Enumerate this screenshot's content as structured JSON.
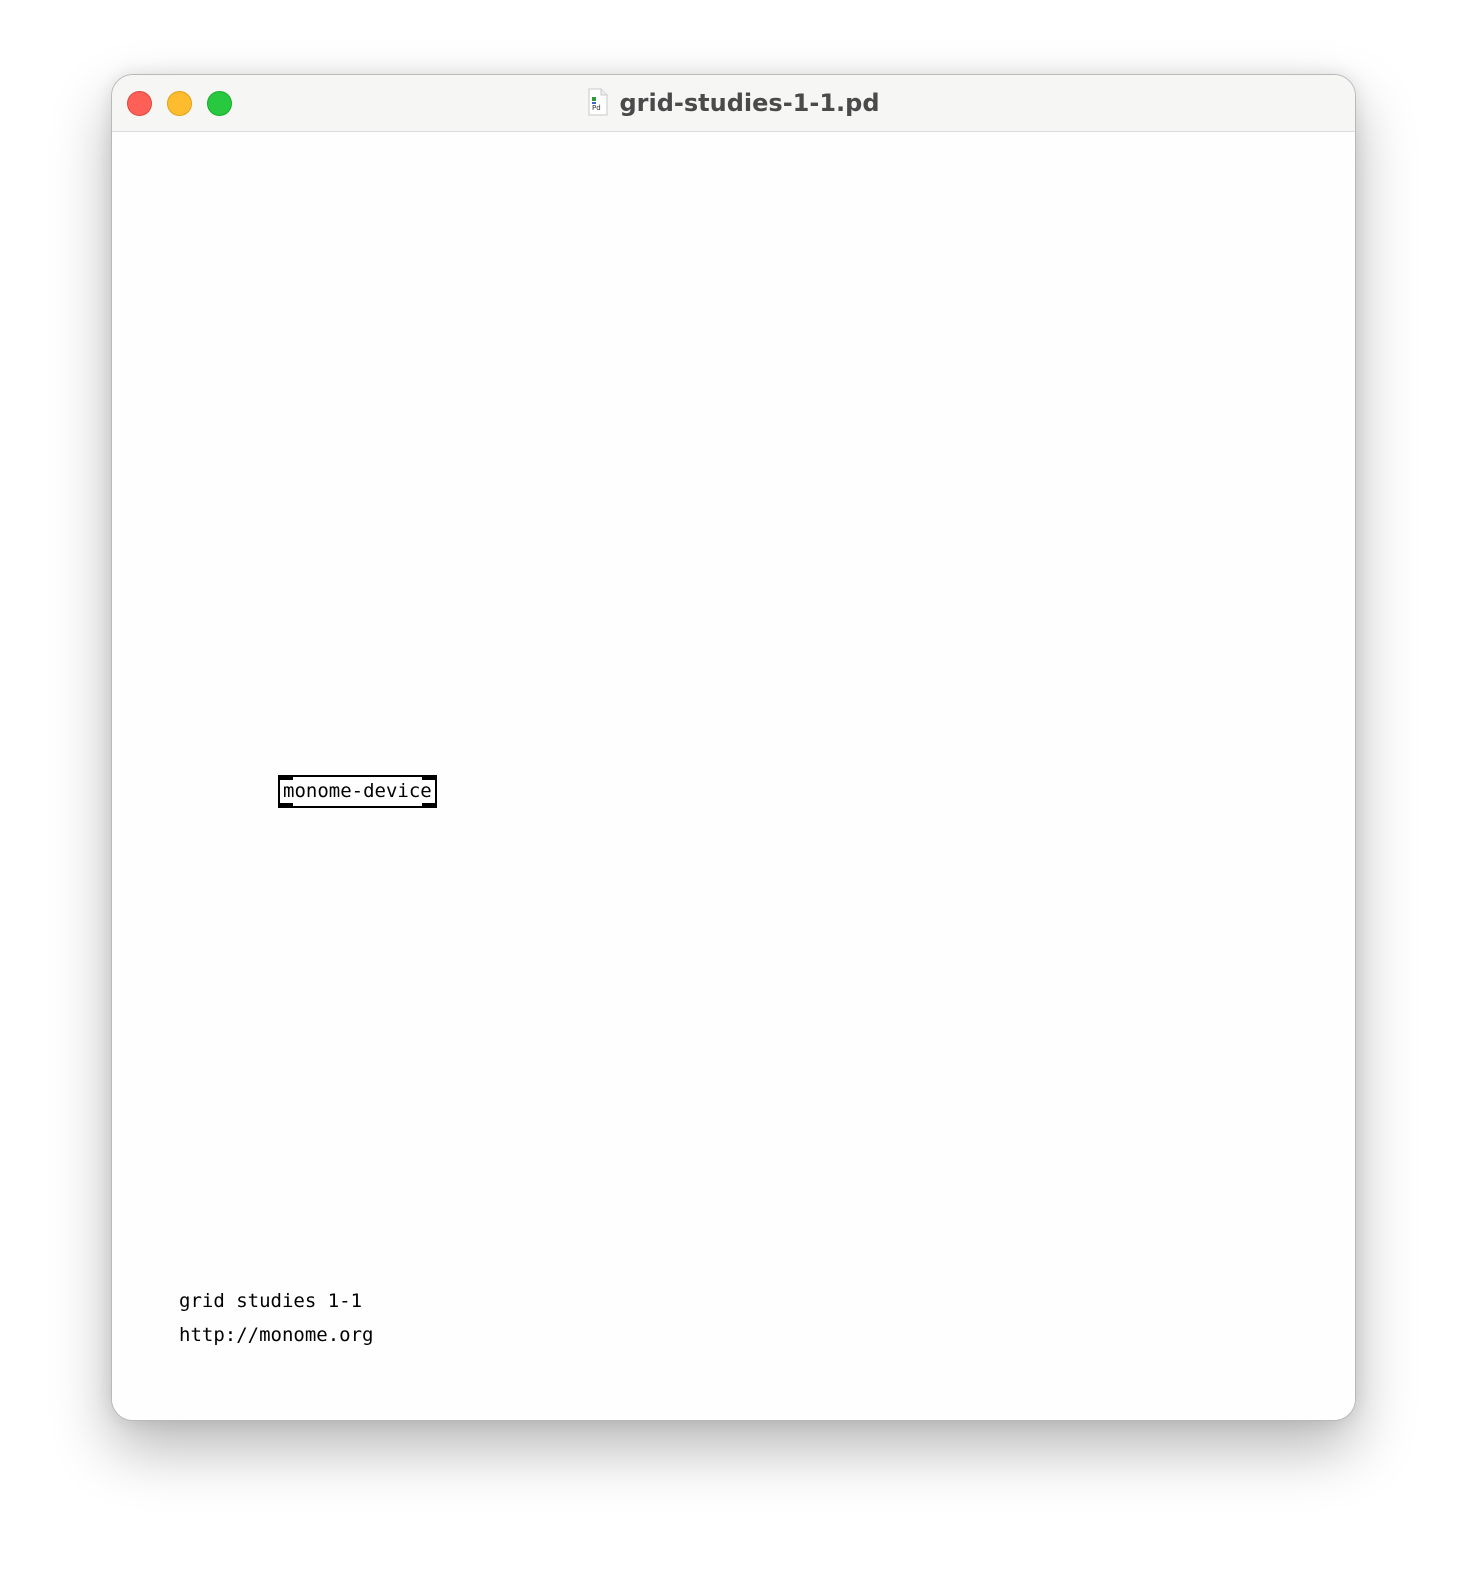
{
  "window": {
    "title": "grid-studies-1-1.pd",
    "file_icon": "pd-document-icon",
    "controls": {
      "close": "close-icon",
      "minimize": "minimize-icon",
      "zoom": "zoom-icon"
    }
  },
  "canvas": {
    "objects": [
      {
        "label": "monome-device"
      }
    ],
    "comments": [
      "grid studies 1-1",
      "http://monome.org"
    ]
  },
  "colors": {
    "close": "#fe5f57",
    "minimize": "#febc2e",
    "zoom": "#28c840",
    "titlebar": "#f6f6f5",
    "canvas": "#fefefe"
  }
}
